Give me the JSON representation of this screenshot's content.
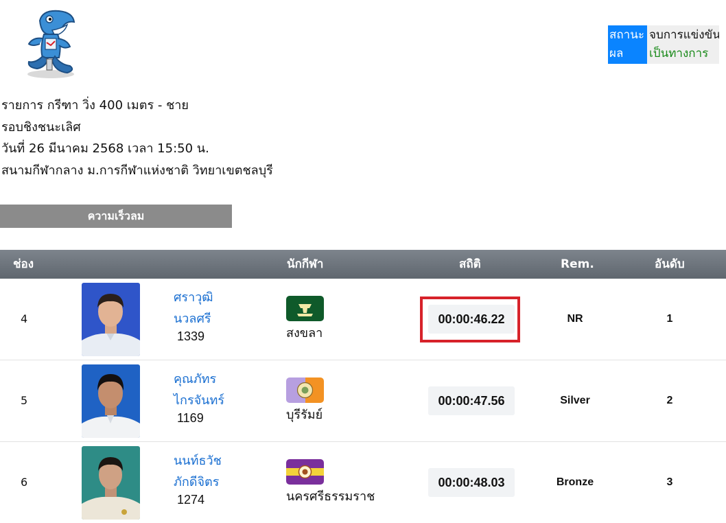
{
  "status": {
    "label": "สถานะผล",
    "value_line1": "จบการแข่งขัน",
    "value_line2": "เป็นทางการ"
  },
  "event": {
    "title": "รายการ กรีฑา วิ่ง 400 เมตร - ชาย",
    "round": "รอบชิงชนะเลิศ",
    "datetime": "วันที่ 26 มีนาคม 2568 เวลา 15:50 น.",
    "venue": "สนามกีฬากลาง ม.การกีฬาแห่งชาติ วิทยาเขตชลบุรี"
  },
  "wind_button": "ความเร็วลม",
  "table": {
    "headers": {
      "lane": "ช่อง",
      "athlete": "นักกีฬา",
      "stat": "สถิติ",
      "rem": "Rem.",
      "rank": "อันดับ"
    },
    "rows": [
      {
        "lane": "4",
        "first_name": "ศราวุฒิ",
        "last_name": "นวลศรี",
        "bib": "1339",
        "team": "สงขลา",
        "time": "00:00:46.22",
        "rem": "NR",
        "rank": "1",
        "highlighted": true
      },
      {
        "lane": "5",
        "first_name": "คุณภัทร",
        "last_name": "ไกรจันทร์",
        "bib": "1169",
        "team": "บุรีรัมย์",
        "time": "00:00:47.56",
        "rem": "Silver",
        "rank": "2",
        "highlighted": false
      },
      {
        "lane": "6",
        "first_name": "นนท์ธวัช",
        "last_name": "ภักดีจิตร",
        "bib": "1274",
        "team": "นครศรีธรรมราช",
        "time": "00:00:48.03",
        "rem": "Bronze",
        "rank": "3",
        "highlighted": false
      }
    ]
  },
  "colors": {
    "status_label_bg": "#0a84ff",
    "status_official": "#1a8a1a",
    "highlight_border": "#d7222a",
    "name_link": "#1a6fd1",
    "header_bg": "#6e757d"
  }
}
